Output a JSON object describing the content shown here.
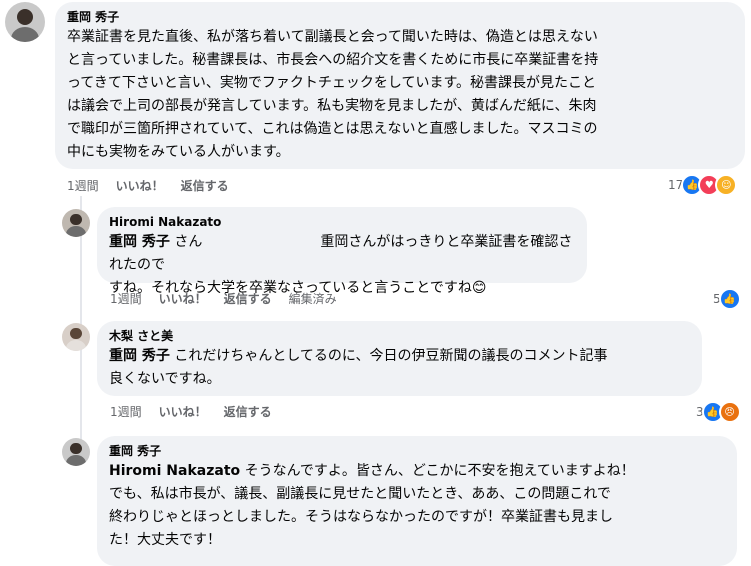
{
  "comments": [
    {
      "author": "重岡 秀子",
      "lines": [
        "卒業証書を見た直後、私が落ち着いて副議長と会って聞いた時は、偽造とは思えない",
        "と言っていました。秘書課長は、市長会への紹介文を書くために市長に卒業証書を持",
        "ってきて下さいと言い、実物でファクトチェックをしています。秘書課長が見たこと",
        "は議会で上司の部長が発言しています。私も実物を見ましたが、黄ばんだ紙に、朱肉",
        "で職印が三箇所押されていて、これは偽造とは思えないと直感しました。マスコミの",
        "中にも実物をみている人がいます。"
      ],
      "time": "1週間",
      "like": "いいね！",
      "reply": "返信する",
      "reaction_count": "17"
    },
    {
      "author": "Hiromi Nakazato",
      "mention": "重岡 秀子",
      "line1_after_mention": " さん",
      "line1_rest": "重岡さんがはっきりと卒業証書を確認されたので",
      "line2": "すね。それなら大学を卒業なさっていると言うことですね😊",
      "time": "1週間",
      "like": "いいね！",
      "reply": "返信する",
      "edited": "編集済み",
      "reaction_count": "5"
    },
    {
      "author": "木梨 さと美",
      "mention": "重岡 秀子",
      "line1_rest": " これだけちゃんとしてるのに、今日の伊豆新聞の議長のコメント記事",
      "line2": "良くないですね。",
      "time": "1週間",
      "like": "いいね！",
      "reply": "返信する",
      "reaction_count": "3"
    },
    {
      "author": "重岡 秀子",
      "mention": "Hiromi Nakazato",
      "line1_rest": " そうなんですよ。皆さん、どこかに不安を抱えていますよね！",
      "lines": [
        "でも、私は市長が、議長、副議長に見せたと聞いたとき、ああ、この問題これで",
        "終わりじゃとほっとしました。そうはならなかったのですが！卒業証書も見まし",
        "た！大丈夫です！"
      ]
    }
  ],
  "colors": {
    "bubble": "#f0f2f5",
    "like": "#1877f2",
    "love": "#f33e58",
    "care": "#f7b125",
    "angry": "#e9710f"
  }
}
